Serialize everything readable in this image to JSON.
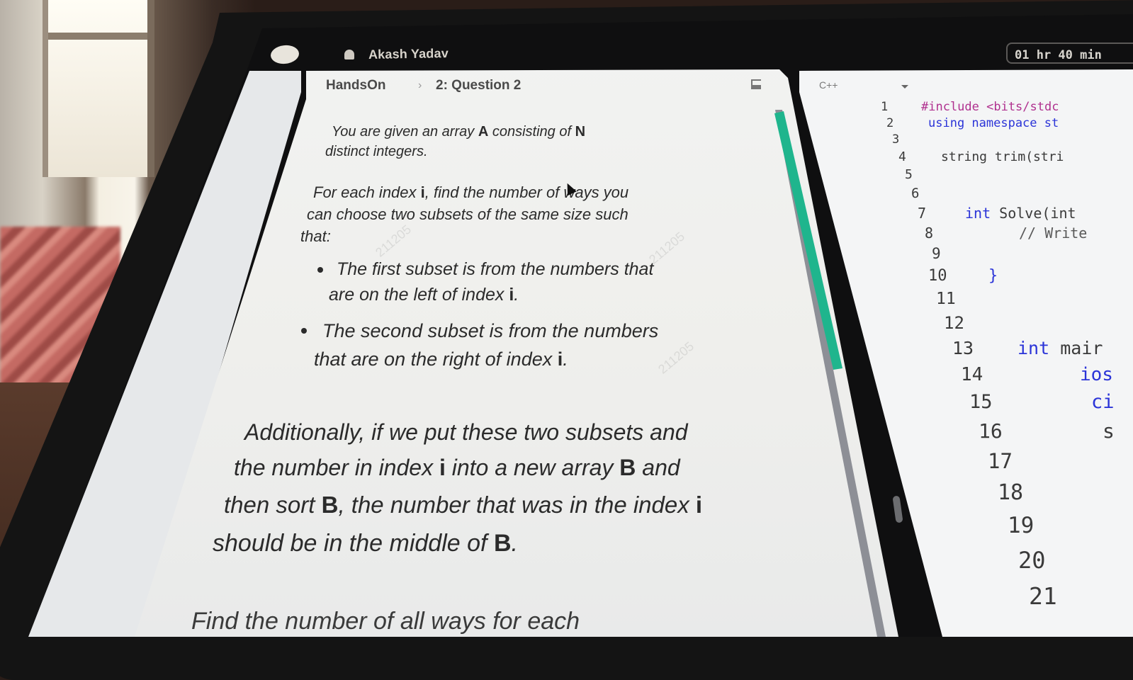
{
  "header": {
    "user_name": "Akash Yadav",
    "timer": "01 hr 40 min"
  },
  "question": {
    "breadcrumb": [
      "HandsOn",
      "2: Question 2"
    ],
    "paragraph1_a": "You are given an array",
    "paragraph1_var_a": "A",
    "paragraph1_b": "consisting of",
    "paragraph1_var_n": "N",
    "paragraph1_c": "distinct integers.",
    "paragraph2_a": "For each index",
    "paragraph2_var_i": "i",
    "paragraph2_b": ", find the number of ways you",
    "paragraph2_c": "can choose two subsets of the same size such",
    "paragraph2_d": "that:",
    "bullet1_a": "The first subset is from the numbers that",
    "bullet1_b": "are on the left of index",
    "bullet2_a": "The second subset is from the numbers",
    "bullet2_b": "that are on the right of index",
    "var_i": "i",
    "period": ".",
    "para3_line1": "Additionally, if we put these two subsets and",
    "para3_line2_a": "the number in index",
    "para3_line2_b": "into a new array",
    "para3_var_b": "B",
    "para3_line2_c": "and",
    "para3_line3_a": "then sort",
    "para3_line3_b": ", the number that was in the index",
    "para3_line4_a": "should be in the middle of",
    "para4_partial": "Find the number of all ways for each",
    "watermark": "211205"
  },
  "editor": {
    "language": "C++",
    "line_numbers": [
      "1",
      "2",
      "3",
      "4",
      "5",
      "6",
      "7",
      "8",
      "9",
      "10",
      "11",
      "12",
      "13",
      "14",
      "15",
      "16",
      "17",
      "18",
      "19",
      "20",
      "21"
    ],
    "lines": {
      "l1": "#include <bits/stdc",
      "l2_kw": "using namespace",
      "l2_rest": "st",
      "l4": "string trim(stri",
      "l7_kw": "int",
      "l7_rest": "Solve(int",
      "l8": "// Write",
      "l10": "}",
      "l13_kw": "int",
      "l13_rest": "mair",
      "l14": "ios",
      "l15": "ci",
      "l16": "s"
    }
  },
  "colors": {
    "scroll_thumb": "#1fb58d",
    "keyword": "#2b34d8",
    "preprocessor": "#b0318f"
  }
}
